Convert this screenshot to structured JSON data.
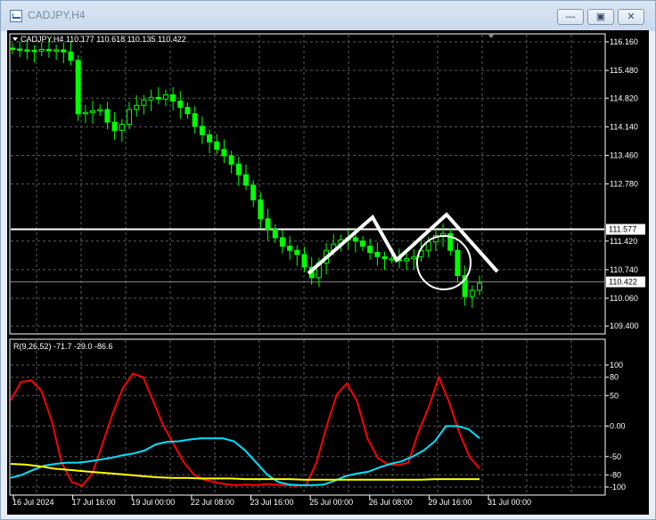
{
  "window": {
    "title": "CADJPY,H4",
    "minimize_glyph": "—",
    "restore_glyph": "▣",
    "close_glyph": "✕"
  },
  "main_chart": {
    "header": "CADJPY,H4  110.177 110.618 110.135 110.422",
    "price_ticks": [
      "116.160",
      "115.480",
      "114.820",
      "114.140",
      "113.460",
      "112.780",
      "111.420",
      "110.740",
      "110.060",
      "109.400"
    ],
    "price_tick_values": [
      116.16,
      115.48,
      114.82,
      114.14,
      113.46,
      112.78,
      111.42,
      110.74,
      110.06,
      109.4
    ],
    "y_range": [
      109.4,
      116.16
    ],
    "levels": [
      {
        "label": "111.577",
        "value": 111.7,
        "line_color": "#ffffff"
      },
      {
        "label": "110.422",
        "value": 110.45,
        "line_color": "#888888"
      }
    ],
    "candle_color": "#00ff00",
    "candles_close": [
      115.99,
      115.97,
      115.96,
      115.94,
      115.98,
      115.95,
      115.97,
      115.92,
      115.72,
      114.45,
      114.48,
      114.52,
      114.55,
      114.25,
      114.05,
      114.2,
      114.55,
      114.65,
      114.78,
      114.84,
      114.8,
      114.9,
      114.75,
      114.6,
      114.45,
      114.15,
      113.95,
      113.78,
      113.6,
      113.45,
      113.25,
      113.0,
      112.75,
      112.4,
      111.95,
      111.7,
      111.5,
      111.3,
      111.2,
      111.1,
      110.8,
      110.55,
      110.9,
      111.2,
      111.35,
      111.45,
      111.5,
      111.42,
      111.3,
      111.15,
      111.05,
      111.0,
      111.0,
      110.95,
      111.0,
      111.05,
      111.2,
      111.4,
      111.55,
      111.6,
      111.2,
      110.6,
      110.1,
      110.25,
      110.42
    ]
  },
  "pattern_overlay": {
    "note_color": "#ffffff",
    "zigzag": [
      [
        338,
        273
      ],
      [
        410,
        210
      ],
      [
        437,
        258
      ],
      [
        493,
        207
      ],
      [
        550,
        271
      ]
    ],
    "circle": {
      "cx": 490,
      "cy": 261,
      "r": 30
    }
  },
  "oscillator": {
    "header": "R(9,26,52) -71.7 -29.0 -86.6",
    "ticks": [
      "100",
      "80",
      "50",
      "0.00",
      "-50",
      "-80",
      "-100"
    ],
    "tick_values": [
      100,
      80,
      50,
      0,
      -50,
      -80,
      -100
    ],
    "y_range": [
      -100,
      100
    ],
    "series": [
      {
        "color": "#ff0000",
        "values": [
          42,
          72,
          75,
          58,
          10,
          -60,
          -92,
          -98,
          -78,
          -30,
          20,
          62,
          86,
          80,
          40,
          0,
          -30,
          -60,
          -80,
          -88,
          -92,
          -95,
          -97,
          -96,
          -97,
          -95,
          -96,
          -97,
          -98,
          -96,
          -60,
          0,
          52,
          70,
          40,
          -20,
          -52,
          -63,
          -64,
          -60,
          -10,
          30,
          80,
          40,
          -10,
          -50,
          -70
        ]
      },
      {
        "color": "#00e0ff",
        "values": [
          -85,
          -80,
          -72,
          -65,
          -62,
          -60,
          -60,
          -58,
          -55,
          -52,
          -48,
          -45,
          -40,
          -30,
          -26,
          -25,
          -22,
          -20,
          -20,
          -20,
          -25,
          -40,
          -60,
          -80,
          -92,
          -96,
          -97,
          -97,
          -96,
          -90,
          -82,
          -78,
          -75,
          -68,
          -62,
          -58,
          -50,
          -40,
          -25,
          0,
          0,
          -5,
          -20
        ]
      },
      {
        "color": "#ffff00",
        "values": [
          -62,
          -63,
          -66,
          -70,
          -72,
          -74,
          -76,
          -78,
          -80,
          -82,
          -84,
          -85,
          -85,
          -86,
          -86,
          -86,
          -87,
          -87,
          -87,
          -87,
          -88,
          -88,
          -88,
          -88,
          -88,
          -88,
          -88,
          -88,
          -88,
          -87,
          -87,
          -87,
          -87
        ]
      }
    ]
  },
  "time_axis": {
    "labels": [
      "16 Jul 2024",
      "17 Jul 16:00",
      "19 Jul 00:00",
      "22 Jul 08:00",
      "23 Jul 16:00",
      "25 Jul 00:00",
      "26 Jul 08:00",
      "29 Jul 16:00",
      "31 Jul 00:00"
    ]
  }
}
